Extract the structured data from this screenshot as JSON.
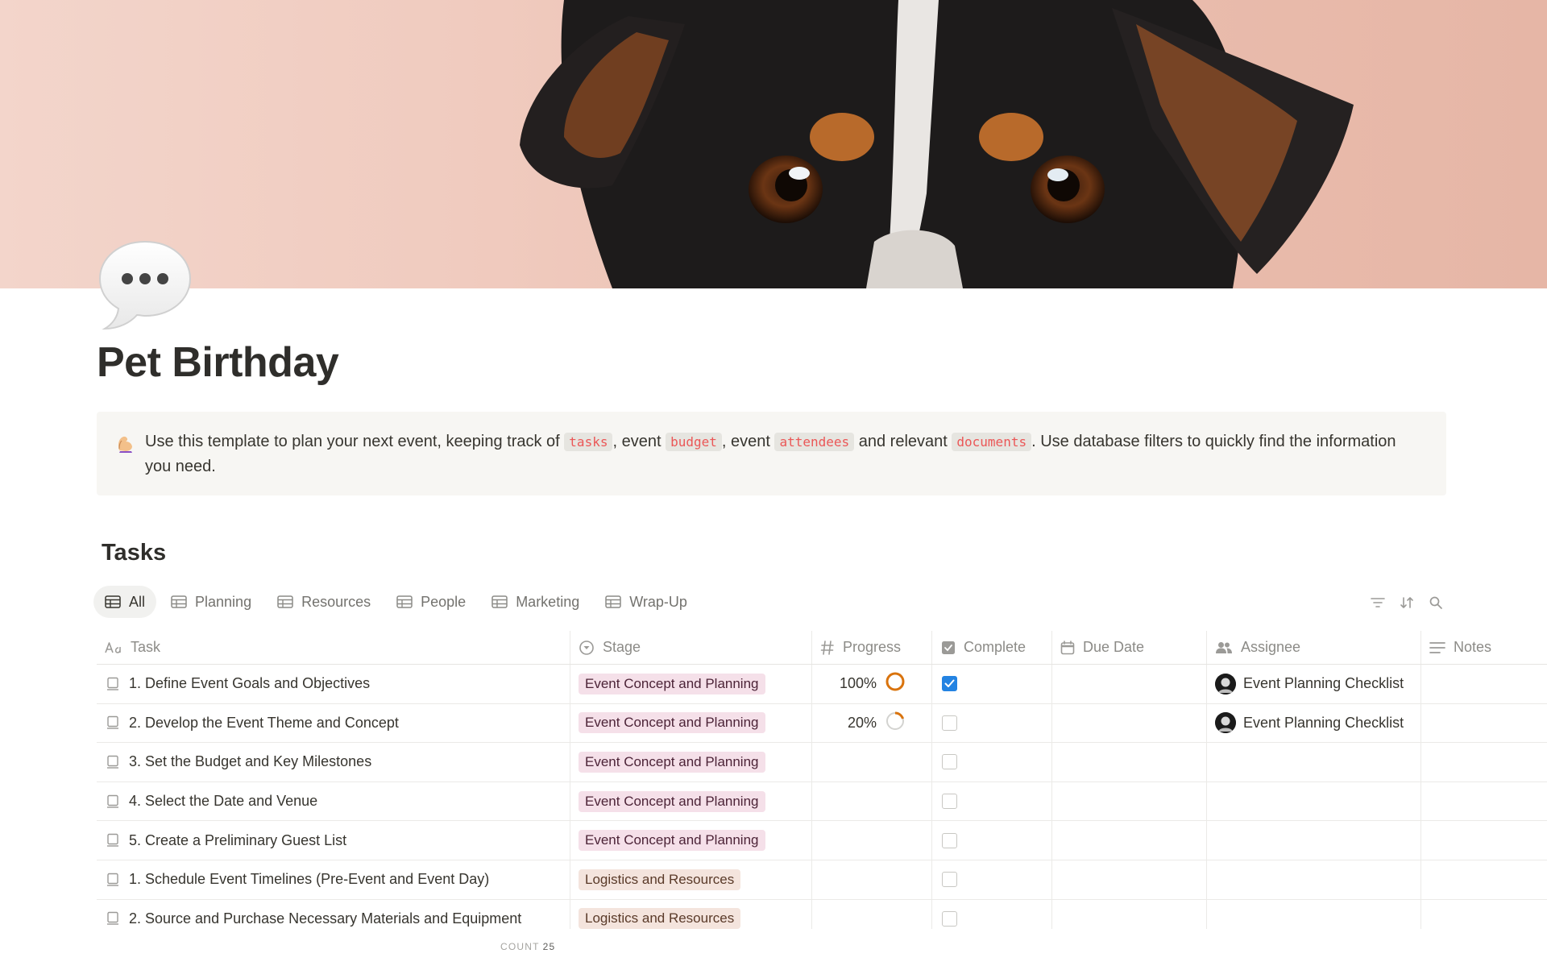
{
  "page": {
    "title": "Pet Birthday",
    "callout": {
      "text_1": "Use this template to plan your next event, keeping track of ",
      "code_1": "tasks",
      "text_2": ", event ",
      "code_2": "budget",
      "text_3": ", event ",
      "code_3": "attendees",
      "text_4": " and relevant ",
      "code_4": "documents",
      "text_5": ". Use database filters to quickly find the information you need."
    }
  },
  "database": {
    "title": "Tasks",
    "views": [
      {
        "label": "All",
        "active": true
      },
      {
        "label": "Planning",
        "active": false
      },
      {
        "label": "Resources",
        "active": false
      },
      {
        "label": "People",
        "active": false
      },
      {
        "label": "Marketing",
        "active": false
      },
      {
        "label": "Wrap-Up",
        "active": false
      }
    ],
    "toolbar": {
      "filter": "filter-icon",
      "sort": "sort-icon",
      "search": "search-icon"
    },
    "columns": {
      "task": "Task",
      "stage": "Stage",
      "progress": "Progress",
      "complete": "Complete",
      "due_date": "Due Date",
      "assignee": "Assignee",
      "notes": "Notes"
    },
    "rows": [
      {
        "task": "1. Define Event Goals and Objectives",
        "stage": "Event Concept and Planning",
        "progress": "100%",
        "progress_value": 1.0,
        "complete": true,
        "assignee": "Event Planning Checklist"
      },
      {
        "task": "2. Develop the Event Theme and Concept",
        "stage": "Event Concept and Planning",
        "progress": "20%",
        "progress_value": 0.2,
        "complete": false,
        "assignee": "Event Planning Checklist"
      },
      {
        "task": "3. Set the Budget and Key Milestones",
        "stage": "Event Concept and Planning",
        "progress": "",
        "complete": false,
        "assignee": ""
      },
      {
        "task": "4. Select the Date and Venue",
        "stage": "Event Concept and Planning",
        "progress": "",
        "complete": false,
        "assignee": ""
      },
      {
        "task": "5. Create a Preliminary Guest List",
        "stage": "Event Concept and Planning",
        "progress": "",
        "complete": false,
        "assignee": ""
      },
      {
        "task": "1. Schedule Event Timelines (Pre-Event and Event Day)",
        "stage": "Logistics and Resources",
        "progress": "",
        "complete": false,
        "assignee": ""
      },
      {
        "task": "2. Source and Purchase Necessary Materials and Equipment",
        "stage": "Logistics and Resources",
        "progress": "",
        "complete": false,
        "assignee": ""
      }
    ],
    "stage_colors": {
      "Event Concept and Planning": {
        "bg": "#f5e0e9",
        "fg": "#4c2337"
      },
      "Logistics and Resources": {
        "bg": "#f4e4dd",
        "fg": "#5a3a29"
      }
    },
    "progress_colors": {
      "done": "#d9730d",
      "partial": "#d3d3d0"
    },
    "count_label": "COUNT",
    "count_value": "25"
  }
}
